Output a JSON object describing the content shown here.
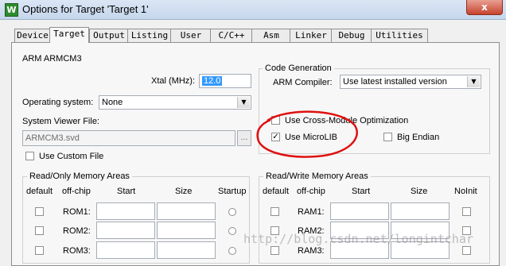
{
  "window": {
    "title": "Options for Target 'Target 1'",
    "close_glyph": "x",
    "icon_letter": "W"
  },
  "tabs": [
    "Device",
    "Target",
    "Output",
    "Listing",
    "User",
    "C/C++",
    "Asm",
    "Linker",
    "Debug",
    "Utilities"
  ],
  "active_tab": "Target",
  "device_name": "ARM ARMCM3",
  "xtal": {
    "label": "Xtal (MHz):",
    "value": "12.0"
  },
  "os": {
    "label": "Operating system:",
    "value": "None"
  },
  "viewer": {
    "label": "System Viewer File:",
    "value": "ARMCM3.svd",
    "browse": "...",
    "custom_label": "Use Custom File"
  },
  "codegen": {
    "title": "Code Generation",
    "compiler_label": "ARM Compiler:",
    "compiler_value": "Use latest installed version",
    "cross_module_label": "Use Cross-Module Optimization",
    "microlib_label": "Use MicroLIB",
    "microlib_checked": true,
    "big_endian_label": "Big Endian"
  },
  "ro_memory": {
    "title": "Read/Only Memory Areas",
    "headers": [
      "default",
      "off-chip",
      "Start",
      "Size",
      "Startup"
    ],
    "rows": [
      "ROM1:",
      "ROM2:",
      "ROM3:"
    ]
  },
  "rw_memory": {
    "title": "Read/Write Memory Areas",
    "headers": [
      "default",
      "off-chip",
      "Start",
      "Size",
      "NoInit"
    ],
    "rows": [
      "RAM1:",
      "RAM2:",
      "RAM3:"
    ]
  },
  "watermark": "http://blog.csdn.net/longintchar",
  "colors": {
    "annotation": "#e01010",
    "selection": "#3399ff"
  }
}
